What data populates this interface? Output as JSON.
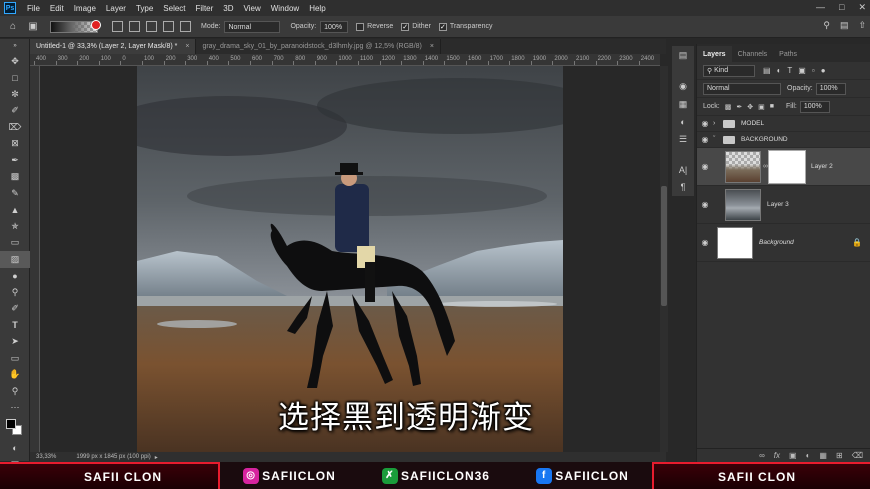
{
  "app": {
    "logo": "Ps",
    "menu": [
      "File",
      "Edit",
      "Image",
      "Layer",
      "Type",
      "Select",
      "Filter",
      "3D",
      "View",
      "Window",
      "Help"
    ]
  },
  "options": {
    "mode_label": "Mode:",
    "mode_value": "Normal",
    "opacity_label": "Opacity:",
    "opacity_value": "100%",
    "reverse_label": "Reverse",
    "dither_label": "Dither",
    "transparency_label": "Transparency",
    "reverse_checked": false,
    "dither_checked": true,
    "transparency_checked": true
  },
  "tabs": [
    {
      "label": "Untitled-1 @ 33,3% (Layer 2, Layer Mask/8) *"
    },
    {
      "label": "gray_drama_sky_01_by_paranoidstock_d3lhmly.jpg @ 12,5% (RGB/8)"
    }
  ],
  "ruler": {
    "top_ticks": [
      "400",
      "300",
      "200",
      "100",
      "0",
      "100",
      "200",
      "300",
      "400",
      "500",
      "600",
      "700",
      "800",
      "900",
      "1000",
      "1100",
      "1200",
      "1300",
      "1400",
      "1500",
      "1600",
      "1700",
      "1800",
      "1900",
      "2000",
      "2100",
      "2200",
      "2300",
      "2400"
    ]
  },
  "subtitle": "选择黑到透明渐变",
  "status": {
    "zoom": "33,33%",
    "doc_info": "1999 px x 1845 px (100 ppi)"
  },
  "layers_panel": {
    "tabs": [
      "Layers",
      "Channels",
      "Paths"
    ],
    "kind_label": "Kind",
    "blend_mode": "Normal",
    "opacity_label": "Opacity:",
    "opacity_value": "100%",
    "lock_label": "Lock:",
    "fill_label": "Fill:",
    "fill_value": "100%",
    "groups": [
      {
        "name": "MODEL",
        "expanded": false
      },
      {
        "name": "BACKGROUND",
        "expanded": true
      }
    ],
    "layers": [
      {
        "name": "Layer 2",
        "has_mask": true,
        "selected": true
      },
      {
        "name": "Layer 3",
        "has_mask": false,
        "selected": false
      },
      {
        "name": "Background",
        "has_mask": false,
        "selected": false,
        "locked": true
      }
    ]
  },
  "banner": {
    "left": "SAFII CLON",
    "right": "SAFII CLON",
    "instagram": "SAFIICLON",
    "twitter": "SAFIICLON36",
    "facebook": "SAFIICLON"
  },
  "colors": {
    "accent_red": "#e81c2e",
    "instagram": "#d6249f",
    "twitter": "#1a9c3a",
    "facebook": "#1877f2"
  }
}
